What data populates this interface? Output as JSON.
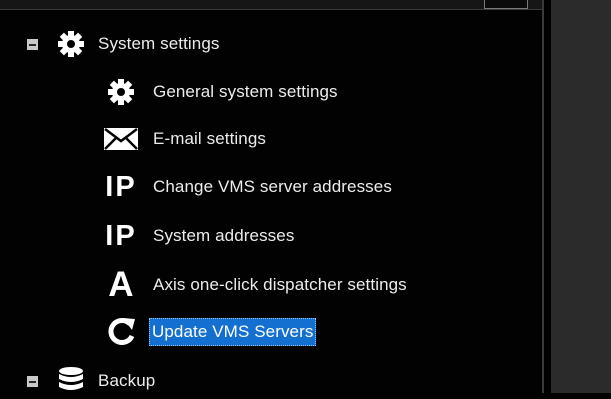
{
  "tree": {
    "system_settings": {
      "label": "System settings",
      "icon": "gear-icon",
      "expanded": true,
      "children": [
        {
          "label": "General system settings",
          "icon": "gear-icon"
        },
        {
          "label": "E-mail settings",
          "icon": "envelope-icon"
        },
        {
          "label": "Change VMS server addresses",
          "icon": "ip-icon",
          "icon_text": "IP"
        },
        {
          "label": "System addresses",
          "icon": "ip-icon",
          "icon_text": "IP"
        },
        {
          "label": "Axis one-click dispatcher settings",
          "icon": "axis-a-icon",
          "icon_text": "A"
        },
        {
          "label": "Update VMS Servers",
          "icon": "refresh-icon",
          "selected": true
        }
      ]
    },
    "backup": {
      "label": "Backup",
      "icon": "database-icon",
      "expanded": true
    }
  },
  "colors": {
    "background": "#020202",
    "text": "#ececec",
    "selection": "#1470d0",
    "right_panel": "#2b2b2b"
  }
}
